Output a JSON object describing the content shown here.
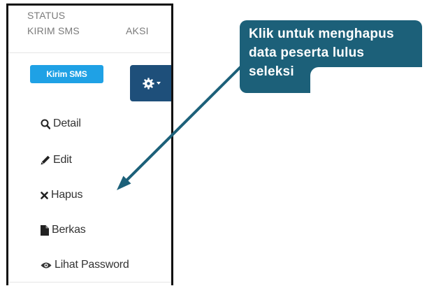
{
  "table_header": {
    "status_line1": "STATUS",
    "status_line2": "KIRIM SMS",
    "aksi": "AKSI"
  },
  "sms_badge": {
    "label": "Kirim SMS",
    "color": "#1fa1e5"
  },
  "action_button": {
    "icon": "gear-icon",
    "caret": "caret-down-icon",
    "color": "#1e4f7a"
  },
  "menu": {
    "items": [
      {
        "icon": "search-icon",
        "label": "Detail"
      },
      {
        "icon": "pencil-icon",
        "label": "Edit"
      },
      {
        "icon": "times-icon",
        "label": "Hapus"
      },
      {
        "icon": "file-icon",
        "label": "Berkas"
      },
      {
        "icon": "eye-icon",
        "label": "Lihat Password"
      }
    ]
  },
  "callout": {
    "text": "Klik untuk menghapus\ndata peserta lulus\nseleksi",
    "color": "#1c6079"
  }
}
